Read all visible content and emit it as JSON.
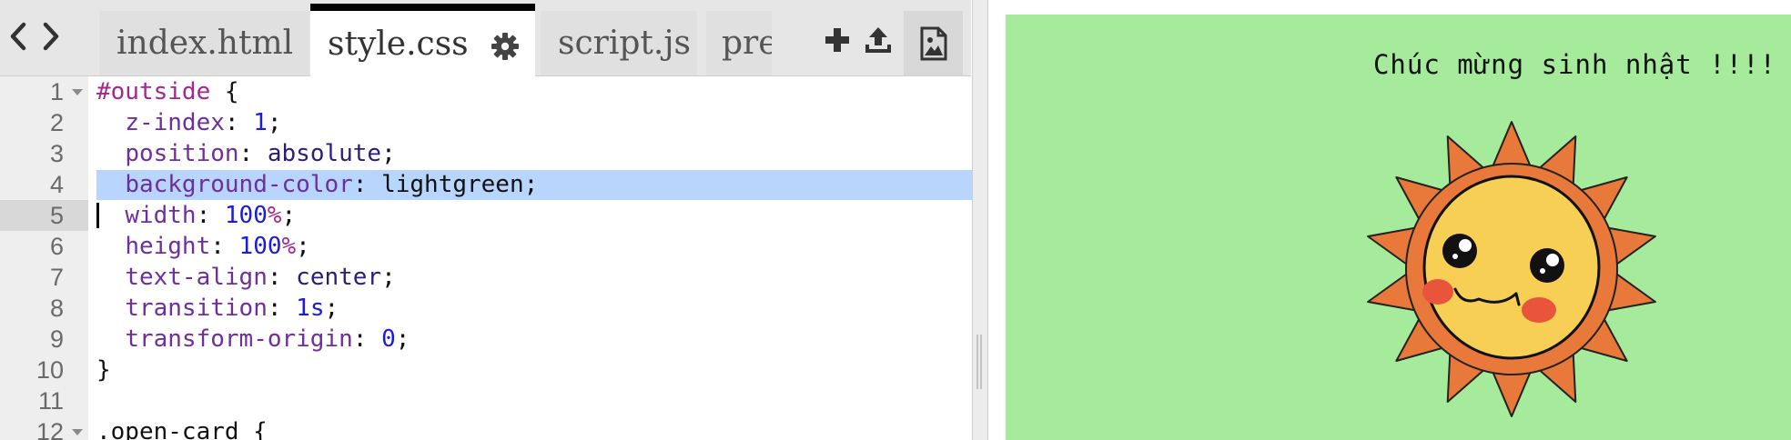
{
  "tabs": [
    {
      "label": "index.html",
      "active": false
    },
    {
      "label": "style.css",
      "active": true
    },
    {
      "label": "script.js",
      "active": false
    },
    {
      "label": "pre",
      "active": false
    }
  ],
  "nav": {
    "back_icon": "chevron-left-icon",
    "forward_icon": "chevron-right-icon"
  },
  "toolbar": {
    "add_icon": "plus-icon",
    "upload_icon": "upload-icon",
    "image_icon": "image-file-icon"
  },
  "editor": {
    "highlighted_line": 4,
    "cursor_line": 5,
    "lines": [
      {
        "n": "1",
        "fold": true,
        "tokens": [
          [
            "sel",
            "#outside"
          ],
          [
            "pun",
            " {"
          ]
        ]
      },
      {
        "n": "2",
        "fold": false,
        "tokens": [
          [
            "plain",
            "  "
          ],
          [
            "prop",
            "z-index"
          ],
          [
            "pun",
            ": "
          ],
          [
            "num",
            "1"
          ],
          [
            "pun",
            ";"
          ]
        ]
      },
      {
        "n": "3",
        "fold": false,
        "tokens": [
          [
            "plain",
            "  "
          ],
          [
            "prop",
            "position"
          ],
          [
            "pun",
            ": "
          ],
          [
            "val",
            "absolute"
          ],
          [
            "pun",
            ";"
          ]
        ]
      },
      {
        "n": "4",
        "fold": false,
        "tokens": [
          [
            "plain",
            "  "
          ],
          [
            "prop",
            "background-color"
          ],
          [
            "pun",
            ": "
          ],
          [
            "plain",
            "lightgreen"
          ],
          [
            "pun",
            ";"
          ]
        ]
      },
      {
        "n": "5",
        "fold": false,
        "tokens": [
          [
            "plain",
            "  "
          ],
          [
            "prop",
            "width"
          ],
          [
            "pun",
            ": "
          ],
          [
            "num",
            "100"
          ],
          [
            "pct",
            "%"
          ],
          [
            "pun",
            ";"
          ]
        ]
      },
      {
        "n": "6",
        "fold": false,
        "tokens": [
          [
            "plain",
            "  "
          ],
          [
            "prop",
            "height"
          ],
          [
            "pun",
            ": "
          ],
          [
            "num",
            "100"
          ],
          [
            "pct",
            "%"
          ],
          [
            "pun",
            ";"
          ]
        ]
      },
      {
        "n": "7",
        "fold": false,
        "tokens": [
          [
            "plain",
            "  "
          ],
          [
            "prop",
            "text-align"
          ],
          [
            "pun",
            ": "
          ],
          [
            "val",
            "center"
          ],
          [
            "pun",
            ";"
          ]
        ]
      },
      {
        "n": "8",
        "fold": false,
        "tokens": [
          [
            "plain",
            "  "
          ],
          [
            "prop",
            "transition"
          ],
          [
            "pun",
            ": "
          ],
          [
            "num",
            "1s"
          ],
          [
            "pun",
            ";"
          ]
        ]
      },
      {
        "n": "9",
        "fold": false,
        "tokens": [
          [
            "plain",
            "  "
          ],
          [
            "prop",
            "transform-origin"
          ],
          [
            "pun",
            ": "
          ],
          [
            "num",
            "0"
          ],
          [
            "pun",
            ";"
          ]
        ]
      },
      {
        "n": "10",
        "fold": false,
        "tokens": [
          [
            "pun",
            "}"
          ]
        ]
      },
      {
        "n": "11",
        "fold": false,
        "tokens": []
      },
      {
        "n": "12",
        "fold": true,
        "tokens": [
          [
            "plain",
            ".open-card {"
          ]
        ]
      }
    ]
  },
  "preview": {
    "greeting": "Chúc mừng sinh nhật !!!!",
    "background_color": "#a5eb9b",
    "image_icon": "sun-face-icon"
  }
}
